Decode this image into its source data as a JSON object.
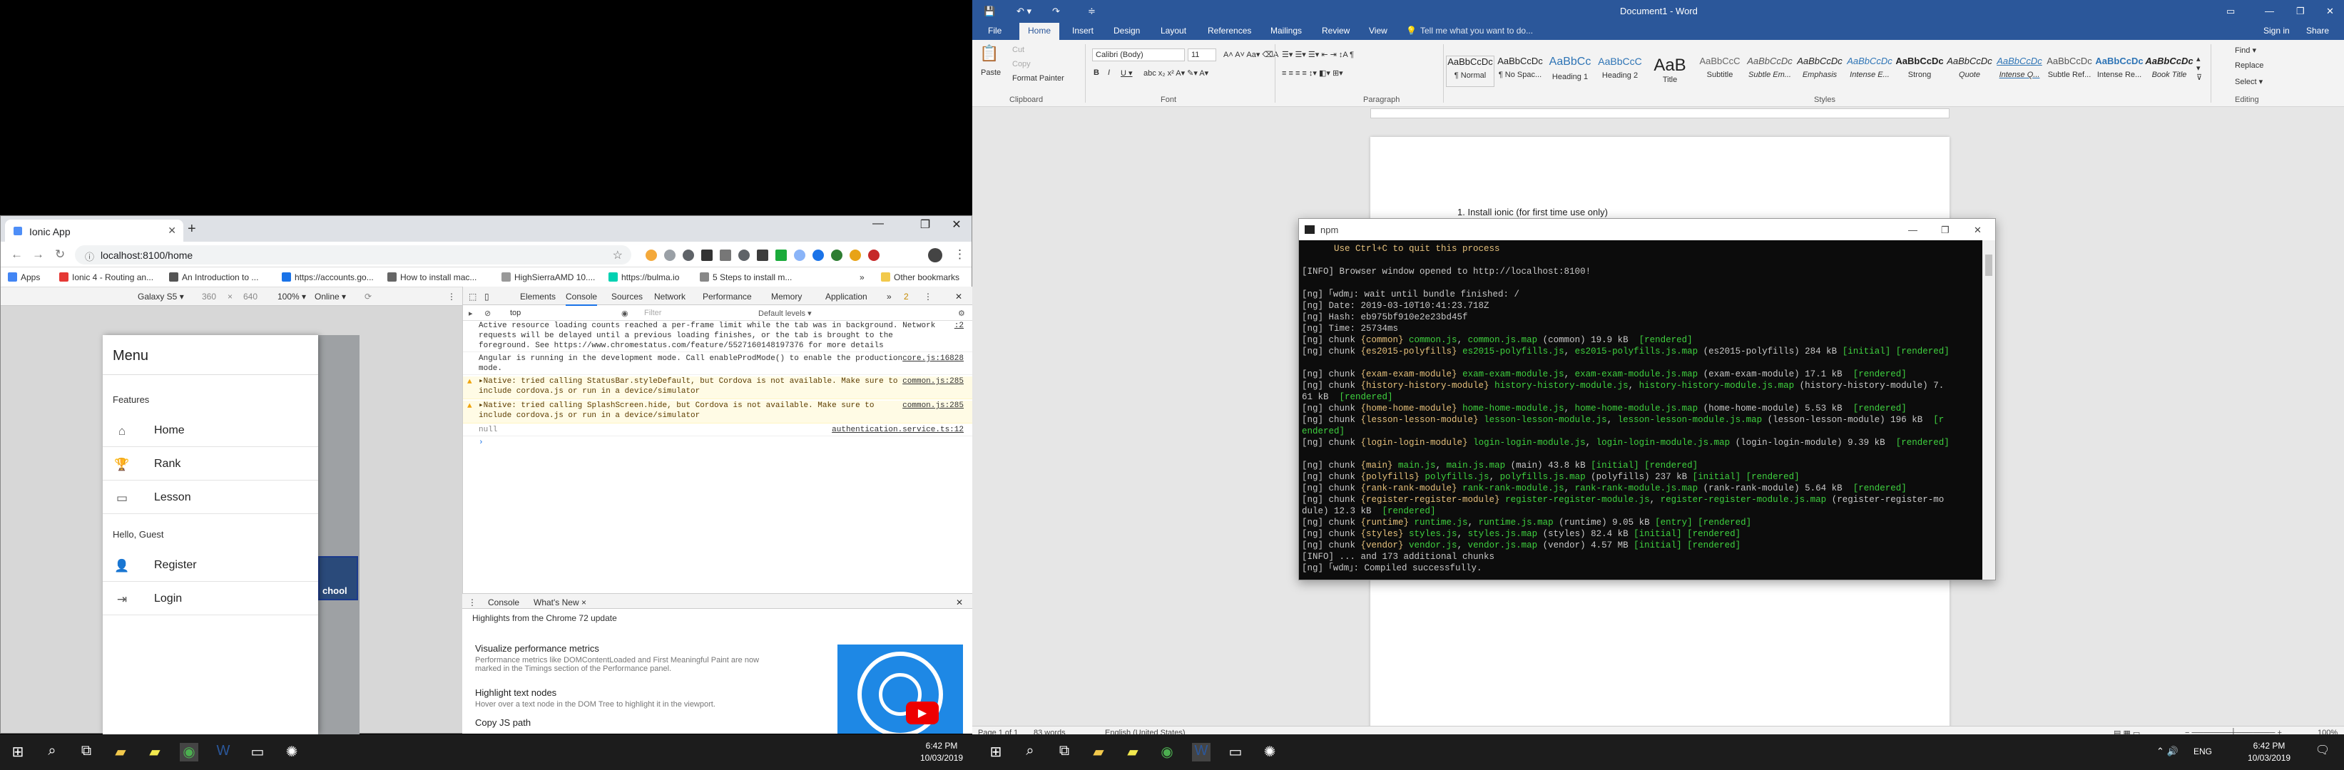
{
  "chrome": {
    "tab_title": "Ionic App",
    "url": "localhost:8100/home",
    "bookmarks": [
      "Apps",
      "Ionic 4 - Routing an...",
      "An Introduction to ...",
      "https://accounts.go...",
      "How to install mac...",
      "HighSierraAMD 10....",
      "https://bulma.io",
      "5 Steps to install m..."
    ],
    "other_bookmarks": "Other bookmarks",
    "device": {
      "name": "Galaxy S5 ▾",
      "width": "360",
      "x": "×",
      "height": "640",
      "zoom": "100% ▾",
      "network": "Online ▾"
    },
    "app": {
      "menu_title": "Menu",
      "section_features": "Features",
      "items_features": [
        {
          "label": "Home",
          "icon": "home-icon"
        },
        {
          "label": "Rank",
          "icon": "trophy-icon"
        },
        {
          "label": "Lesson",
          "icon": "book-icon"
        }
      ],
      "section_guest": "Hello, Guest",
      "items_guest": [
        {
          "label": "Register",
          "icon": "person-add-icon"
        },
        {
          "label": "Login",
          "icon": "login-icon"
        }
      ],
      "thumb_text": "chool"
    },
    "devtools": {
      "tabs": [
        "Elements",
        "Console",
        "Sources",
        "Network",
        "Performance",
        "Memory",
        "Application"
      ],
      "active_tab": "Console",
      "context": "top",
      "filter_placeholder": "Filter",
      "levels": "Default levels ▾",
      "badge": "2",
      "logs": [
        {
          "text": "Active resource loading counts reached a per-frame limit while the tab was in background. Network requests will be delayed until a previous loading finishes, or the tab is brought to the foreground. See https://www.chromestatus.com/feature/5527160148197376 for more details",
          "src": ":2",
          "warn": false
        },
        {
          "text": "Angular is running in the development mode. Call enableProdMode() to enable the production mode.",
          "src": "core.js:16828",
          "warn": false
        },
        {
          "text": "▸Native: tried calling StatusBar.styleDefault, but Cordova is not available. Make sure to include cordova.js or run in a device/simulator",
          "src": "common.js:285",
          "warn": true
        },
        {
          "text": "▸Native: tried calling SplashScreen.hide, but Cordova is not available. Make sure to include cordova.js or run in a device/simulator",
          "src": "common.js:285",
          "warn": true
        },
        {
          "text": "null",
          "src": "authentication.service.ts:12",
          "warn": false
        }
      ],
      "drawer_tabs": [
        "Console",
        "What's New ×"
      ],
      "whats_new_header": "Highlights from the Chrome 72 update",
      "whats_new": [
        {
          "title": "Visualize performance metrics",
          "desc": "Performance metrics like DOMContentLoaded and First Meaningful Paint are now marked in the Timings section of the Performance panel."
        },
        {
          "title": "Highlight text nodes",
          "desc": "Hover over a text node in the DOM Tree to highlight it in the viewport."
        },
        {
          "title": "Copy JS path",
          "desc": ""
        }
      ]
    }
  },
  "word": {
    "title": "Document1 - Word",
    "signin": "Sign in",
    "share": "Share",
    "menu": [
      "File",
      "Home",
      "Insert",
      "Design",
      "Layout",
      "References",
      "Mailings",
      "Review",
      "View"
    ],
    "tell_me": "Tell me what you want to do...",
    "clipboard": {
      "paste": "Paste",
      "cut": "Cut",
      "copy": "Copy",
      "format_painter": "Format Painter",
      "label": "Clipboard"
    },
    "font": {
      "name": "Calibri (Body)",
      "size": "11",
      "label": "Font"
    },
    "paragraph_label": "Paragraph",
    "styles": [
      {
        "preview": "AaBbCcDc",
        "name": "¶ Normal"
      },
      {
        "preview": "AaBbCcDc",
        "name": "¶ No Spac..."
      },
      {
        "preview": "AaBbCc",
        "name": "Heading 1"
      },
      {
        "preview": "AaBbCcC",
        "name": "Heading 2"
      },
      {
        "preview": "AaB",
        "name": "Title"
      },
      {
        "preview": "AaBbCcC",
        "name": "Subtitle"
      },
      {
        "preview": "AaBbCcDc",
        "name": "Subtle Em..."
      },
      {
        "preview": "AaBbCcDc",
        "name": "Emphasis"
      },
      {
        "preview": "AaBbCcDc",
        "name": "Intense E..."
      },
      {
        "preview": "AaBbCcDc",
        "name": "Strong"
      },
      {
        "preview": "AaBbCcDc",
        "name": "Quote"
      },
      {
        "preview": "AaBbCcDc",
        "name": "Intense Q..."
      },
      {
        "preview": "AaBbCcDc",
        "name": "Subtle Ref..."
      },
      {
        "preview": "AaBbCcDc",
        "name": "Intense Re..."
      },
      {
        "preview": "AaBbCcDc",
        "name": "Book Title"
      }
    ],
    "styles_label": "Styles",
    "editing": {
      "find": "Find ▾",
      "replace": "Replace",
      "select": "Select ▾",
      "label": "Editing"
    },
    "doc_line": "1.   Install ionic (for first time use only)",
    "status": {
      "page": "Page 1 of 1",
      "words": "83 words",
      "lang": "English (United States)",
      "zoom": "100%"
    }
  },
  "terminal": {
    "title": "npm",
    "lines": [
      {
        "t": "      Use Ctrl+C to quit this process",
        "c": "#e5c07b"
      },
      {
        "t": "",
        "c": "#c8c8c8"
      },
      {
        "t": "[INFO] Browser window opened to http://localhost:8100!",
        "c": "#c8c8c8"
      },
      {
        "t": "",
        "c": "#c8c8c8"
      },
      {
        "t": "[ng] ｢wdm｣: wait until bundle finished: /",
        "c": "#c8c8c8"
      },
      {
        "t": "[ng] Date: 2019-03-10T10:41:23.718Z",
        "c": "#c8c8c8"
      },
      {
        "t": "[ng] Hash: eb975bf910e2e23bd45f",
        "c": "#c8c8c8"
      },
      {
        "t": "[ng] Time: 25734ms",
        "c": "#c8c8c8"
      },
      {
        "t": "[ng] chunk {common} common.js, common.js.map (common) 19.9 kB  [rendered]",
        "c": "#c8c8c8"
      },
      {
        "t": "[ng] chunk {es2015-polyfills} es2015-polyfills.js, es2015-polyfills.js.map (es2015-polyfills) 284 kB [initial] [rendered]",
        "c": "#c8c8c8"
      },
      {
        "t": "",
        "c": "#c8c8c8"
      },
      {
        "t": "[ng] chunk {exam-exam-module} exam-exam-module.js, exam-exam-module.js.map (exam-exam-module) 17.1 kB  [rendered]",
        "c": "#c8c8c8"
      },
      {
        "t": "[ng] chunk {history-history-module} history-history-module.js, history-history-module.js.map (history-history-module) 7.",
        "c": "#c8c8c8"
      },
      {
        "t": "61 kB  [rendered]",
        "c": "#c8c8c8"
      },
      {
        "t": "[ng] chunk {home-home-module} home-home-module.js, home-home-module.js.map (home-home-module) 5.53 kB  [rendered]",
        "c": "#c8c8c8"
      },
      {
        "t": "[ng] chunk {lesson-lesson-module} lesson-lesson-module.js, lesson-lesson-module.js.map (lesson-lesson-module) 196 kB  [r",
        "c": "#c8c8c8"
      },
      {
        "t": "endered]",
        "c": "#c8c8c8"
      },
      {
        "t": "[ng] chunk {login-login-module} login-login-module.js, login-login-module.js.map (login-login-module) 9.39 kB  [rendered]",
        "c": "#c8c8c8"
      },
      {
        "t": "",
        "c": "#c8c8c8"
      },
      {
        "t": "[ng] chunk {main} main.js, main.js.map (main) 43.8 kB [initial] [rendered]",
        "c": "#c8c8c8"
      },
      {
        "t": "[ng] chunk {polyfills} polyfills.js, polyfills.js.map (polyfills) 237 kB [initial] [rendered]",
        "c": "#c8c8c8"
      },
      {
        "t": "[ng] chunk {rank-rank-module} rank-rank-module.js, rank-rank-module.js.map (rank-rank-module) 5.64 kB  [rendered]",
        "c": "#c8c8c8"
      },
      {
        "t": "[ng] chunk {register-register-module} register-register-module.js, register-register-module.js.map (register-register-mo",
        "c": "#c8c8c8"
      },
      {
        "t": "dule) 12.3 kB  [rendered]",
        "c": "#c8c8c8"
      },
      {
        "t": "[ng] chunk {runtime} runtime.js, runtime.js.map (runtime) 9.05 kB [entry] [rendered]",
        "c": "#c8c8c8"
      },
      {
        "t": "[ng] chunk {styles} styles.js, styles.js.map (styles) 82.4 kB [initial] [rendered]",
        "c": "#c8c8c8"
      },
      {
        "t": "[ng] chunk {vendor} vendor.js, vendor.js.map (vendor) 4.57 MB [initial] [rendered]",
        "c": "#c8c8c8"
      },
      {
        "t": "[INFO] ... and 173 additional chunks",
        "c": "#c8c8c8"
      },
      {
        "t": "[ng] ｢wdm｣: Compiled successfully.",
        "c": "#c8c8c8"
      }
    ]
  },
  "taskbar_left": {
    "time": "6:42 PM",
    "date": "10/03/2019"
  },
  "taskbar_right": {
    "time": "6:42 PM",
    "date": "10/03/2019",
    "lang": "ENG"
  }
}
